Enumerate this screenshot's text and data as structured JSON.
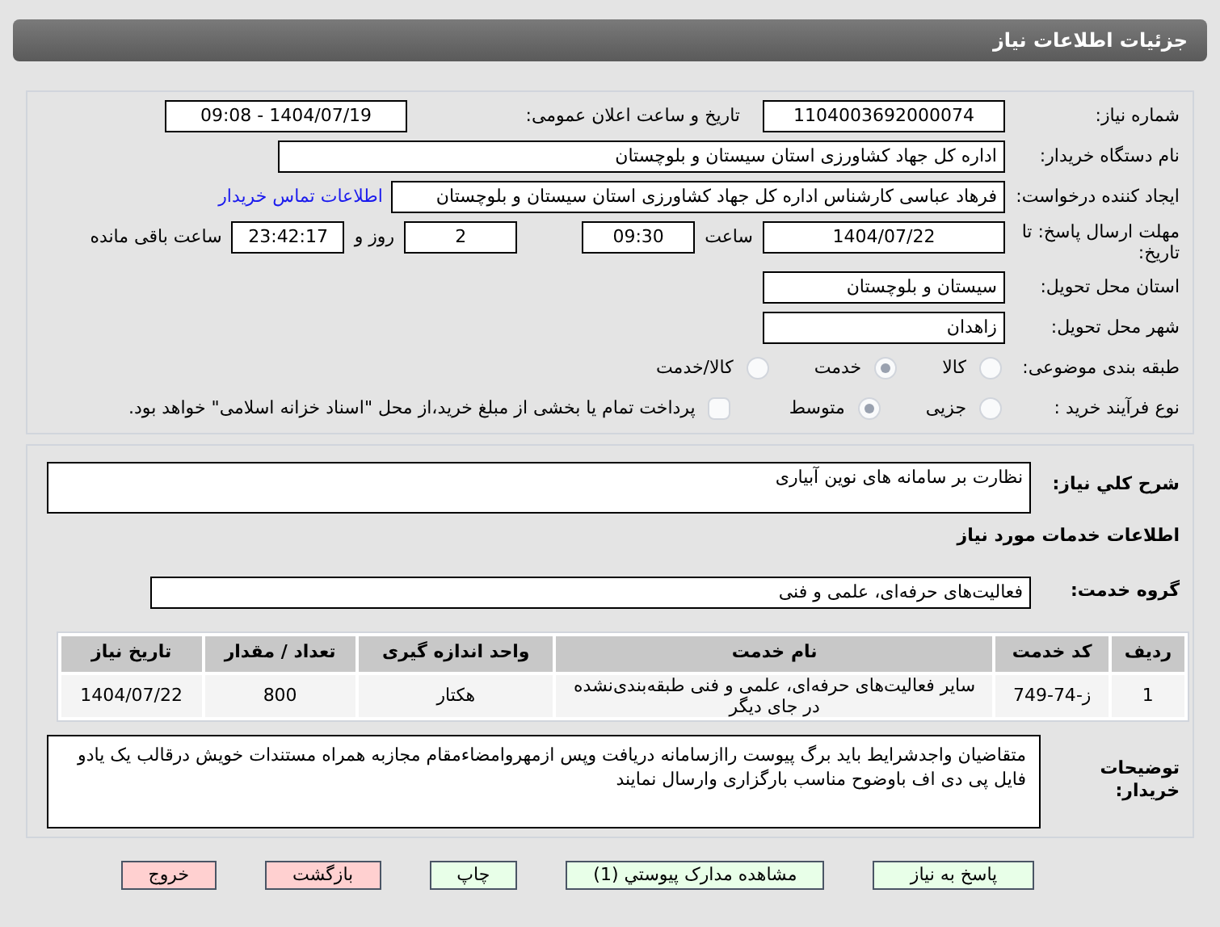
{
  "header": {
    "title": "جزئیات اطلاعات نیاز"
  },
  "need_number": {
    "label": "شماره نیاز:",
    "value": "1104003692000074"
  },
  "announce": {
    "label": "تاریخ و ساعت اعلان عمومی:",
    "value": "1404/07/19 - 09:08"
  },
  "buyer": {
    "label": "نام دستگاه خریدار:",
    "value": "اداره کل جهاد کشاورزی استان سیستان و بلوچستان"
  },
  "creator": {
    "label": "ایجاد کننده درخواست:",
    "value": "فرهاد عباسی کارشناس  اداره کل جهاد کشاورزی استان سیستان و بلوچستان",
    "link": "اطلاعات تماس خریدار"
  },
  "deadline": {
    "label": "مهلت ارسال پاسخ: تا تاریخ:",
    "date": "1404/07/22",
    "time_label": "ساعت",
    "time": "09:30",
    "days": "2",
    "days_label": "روز و",
    "remaining": "23:42:17",
    "remaining_label": "ساعت باقی مانده"
  },
  "province": {
    "label": "استان محل تحویل:",
    "value": "سیستان و بلوچستان"
  },
  "city": {
    "label": "شهر محل تحویل:",
    "value": "زاهدان"
  },
  "category": {
    "label": "طبقه بندی موضوعی:",
    "options": [
      {
        "label": "کالا",
        "selected": false
      },
      {
        "label": "خدمت",
        "selected": true
      },
      {
        "label": "کالا/خدمت",
        "selected": false
      }
    ]
  },
  "purchase_type": {
    "label": "نوع فرآیند خرید :",
    "options": [
      {
        "label": "جزیی",
        "selected": false
      },
      {
        "label": "متوسط",
        "selected": true
      }
    ],
    "payment": {
      "label": "پرداخت تمام یا بخشی از مبلغ خرید،از محل \"اسناد خزانه اسلامی\" خواهد بود.",
      "checked": false
    }
  },
  "description": {
    "label": "شرح کلي نياز:",
    "value": "نظارت بر سامانه های نوین آبیاری"
  },
  "services_title": "اطلاعات خدمات مورد نیاز",
  "service_group": {
    "label": "گروه خدمت:",
    "value": "فعالیت‌های حرفه‌ای، علمی و فنی"
  },
  "table": {
    "columns": [
      "ردیف",
      "کد خدمت",
      "نام خدمت",
      "واحد اندازه گیری",
      "تعداد / مقدار",
      "تاریخ نیاز"
    ],
    "rows": [
      [
        "1",
        "ز-74-749",
        "سایر فعالیت‌های حرفه‌ای، علمی و فنی طبقه‌بندی‌نشده در جای دیگر",
        "هکتار",
        "800",
        "1404/07/22"
      ]
    ]
  },
  "notes": {
    "label": "توضیحات خریدار:",
    "value": "متقاضیان واجدشرایط باید برگ پیوست راازسامانه دریافت وپس ازمهروامضاءمقام مجازبه همراه مستندات  خویش درقالب یک یادو فایل پی دی اف باوضوح مناسب بارگزاری وارسال نمایند"
  },
  "buttons": [
    {
      "label": "پاسخ به نیاز",
      "kind": "action"
    },
    {
      "label": "مشاهده مدارک پیوستي (1)",
      "kind": "action"
    },
    {
      "label": "چاپ",
      "kind": "action"
    },
    {
      "label": "بازگشت",
      "kind": "exit"
    },
    {
      "label": "خروج",
      "kind": "exit"
    }
  ]
}
